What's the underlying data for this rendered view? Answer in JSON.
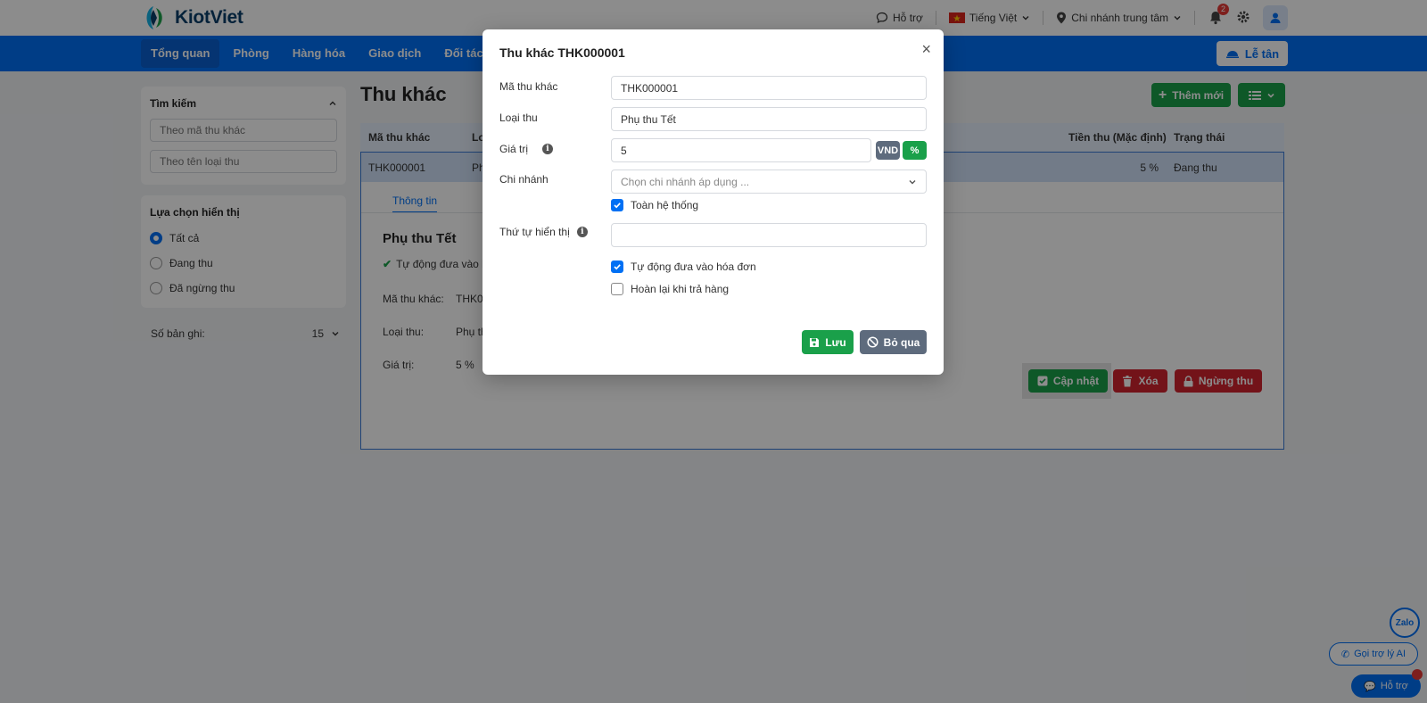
{
  "app": {
    "name": "KiotViet"
  },
  "topbar": {
    "support": "Hỗ trợ",
    "language": "Tiếng Việt",
    "branch": "Chi nhánh trung tâm",
    "notification_count": "2"
  },
  "nav": {
    "items": [
      {
        "label": "Tổng quan"
      },
      {
        "label": "Phòng"
      },
      {
        "label": "Hàng hóa"
      },
      {
        "label": "Giao dịch"
      },
      {
        "label": "Đối tác"
      }
    ],
    "reception": "Lễ tân"
  },
  "sidebar": {
    "search": {
      "title": "Tìm kiếm",
      "placeholder_code": "Theo mã thu khác",
      "placeholder_type": "Theo tên loại thu"
    },
    "display": {
      "title": "Lựa chọn hiển thị",
      "options": [
        {
          "label": "Tất cả"
        },
        {
          "label": "Đang thu"
        },
        {
          "label": "Đã ngừng thu"
        }
      ]
    },
    "records": {
      "label": "Số bản ghi:",
      "value": "15"
    }
  },
  "main": {
    "title": "Thu khác",
    "add_button": "Thêm mới",
    "table": {
      "headers": [
        "Mã thu khác",
        "Lo",
        "Tiền thu (Mặc định)",
        "Trạng thái"
      ],
      "row": {
        "code": "THK000001",
        "type_partial": "Ph",
        "amount": "5 %",
        "status": "Đang thu"
      }
    },
    "detail": {
      "tab": "Thông tin",
      "title": "Phụ thu Tết",
      "auto_invoice_partial": "Tự động đưa vào h",
      "fields": [
        {
          "label": "Mã thu khác:",
          "value": "THK0"
        },
        {
          "label": "Loại thu:",
          "value": "Phụ th"
        },
        {
          "label": "Giá trị:",
          "value": "5 %"
        }
      ],
      "buttons": {
        "update": "Cập nhật",
        "delete": "Xóa",
        "stop": "Ngừng thu"
      }
    }
  },
  "modal": {
    "title": "Thu khác THK000001",
    "labels": {
      "code": "Mã thu khác",
      "type": "Loại thu",
      "value": "Giá trị",
      "branch": "Chi nhánh",
      "order": "Thứ tự hiển thị"
    },
    "values": {
      "code": "THK000001",
      "type": "Phụ thu Tết",
      "value": "5",
      "order": ""
    },
    "branch_placeholder": "Chọn chi nhánh áp dụng ...",
    "unit_vnd": "VND",
    "unit_percent": "%",
    "checkboxes": {
      "whole_system": "Toàn hệ thống",
      "auto_invoice": "Tự động đưa vào hóa đơn",
      "refund": "Hoàn lại khi trả hàng"
    },
    "save": "Lưu",
    "skip": "Bỏ qua"
  },
  "floating": {
    "zalo": "Zalo",
    "ai": "Gọi trợ lý AI",
    "support": "Hỗ trợ"
  },
  "colors": {
    "primary": "#0070f4",
    "green": "#1aa04a",
    "red": "#d1242f",
    "gray": "#5e6b7d"
  }
}
